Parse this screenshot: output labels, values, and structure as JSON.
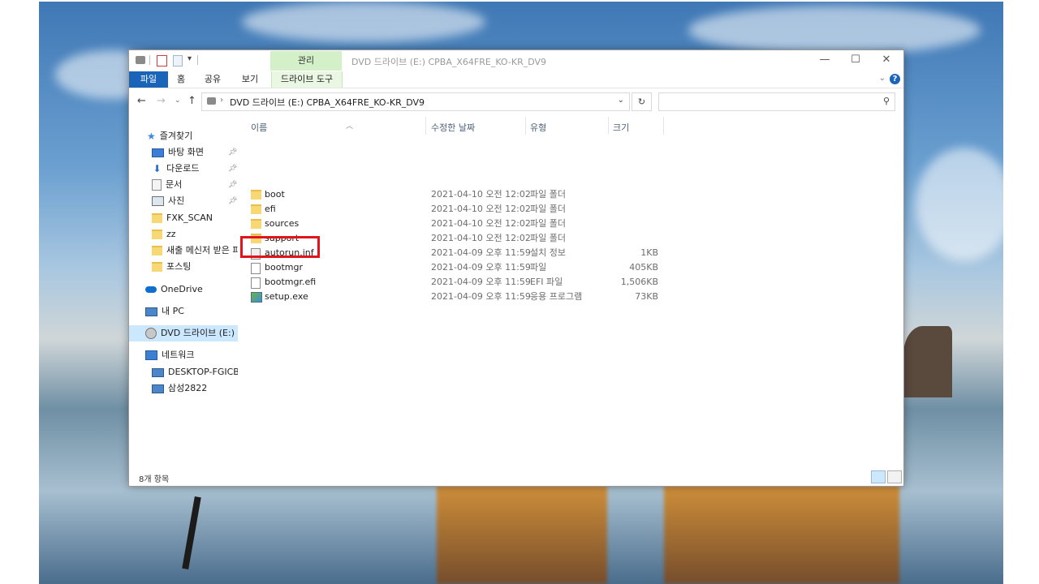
{
  "window": {
    "title": "DVD 드라이브 (E:) CPBA_X64FRE_KO-KR_DV9",
    "context_tab": "관리",
    "controls": {
      "minimize": "—",
      "maximize": "☐",
      "close": "✕"
    }
  },
  "ribbon": {
    "tabs": [
      "파일",
      "홈",
      "공유",
      "보기",
      "드라이브 도구"
    ],
    "help": "?"
  },
  "address": {
    "path": "DVD 드라이브 (E:) CPBA_X64FRE_KO-KR_DV9",
    "search_placeholder": ""
  },
  "nav": {
    "quick_access": "즐겨찾기",
    "items": [
      {
        "label": "바탕 화면",
        "pinned": true
      },
      {
        "label": "다운로드",
        "pinned": true
      },
      {
        "label": "문서",
        "pinned": true
      },
      {
        "label": "사진",
        "pinned": true
      },
      {
        "label": "FXK_SCAN",
        "pinned": false
      },
      {
        "label": "zz",
        "pinned": false
      },
      {
        "label": "새출 메신저 받은 파",
        "pinned": false
      },
      {
        "label": "포스팅",
        "pinned": false
      }
    ],
    "onedrive": "OneDrive",
    "this_pc": "내 PC",
    "dvd": "DVD 드라이브 (E:) C",
    "network": "네트워크",
    "network_items": [
      "DESKTOP-FGICBFN",
      "삼성2822"
    ]
  },
  "columns": {
    "name": "이름",
    "date": "수정한 날짜",
    "type": "유형",
    "size": "크기"
  },
  "files": [
    {
      "name": "boot",
      "date": "2021-04-10 오전 12:02",
      "type": "파일 폴더",
      "size": "",
      "icon": "folder-icon"
    },
    {
      "name": "efi",
      "date": "2021-04-10 오전 12:02",
      "type": "파일 폴더",
      "size": "",
      "icon": "folder-icon"
    },
    {
      "name": "sources",
      "date": "2021-04-10 오전 12:02",
      "type": "파일 폴더",
      "size": "",
      "icon": "folder-icon"
    },
    {
      "name": "support",
      "date": "2021-04-10 오전 12:02",
      "type": "파일 폴더",
      "size": "",
      "icon": "folder-icon"
    },
    {
      "name": "autorun.inf",
      "date": "2021-04-09 오후 11:59",
      "type": "설치 정보",
      "size": "1KB",
      "icon": "setup-info-icon"
    },
    {
      "name": "bootmgr",
      "date": "2021-04-09 오후 11:59",
      "type": "파일",
      "size": "405KB",
      "icon": "file-icon"
    },
    {
      "name": "bootmgr.efi",
      "date": "2021-04-09 오후 11:59",
      "type": "EFI 파일",
      "size": "1,506KB",
      "icon": "file-icon"
    },
    {
      "name": "setup.exe",
      "date": "2021-04-09 오후 11:59",
      "type": "응용 프로그램",
      "size": "73KB",
      "icon": "setup-exe-icon"
    }
  ],
  "status": {
    "item_count": "8개 항목"
  },
  "colors": {
    "accent": "#1a65b9",
    "context_tab": "#d4f0c8",
    "highlight": "#e0141a",
    "selected": "#cce8ff"
  }
}
